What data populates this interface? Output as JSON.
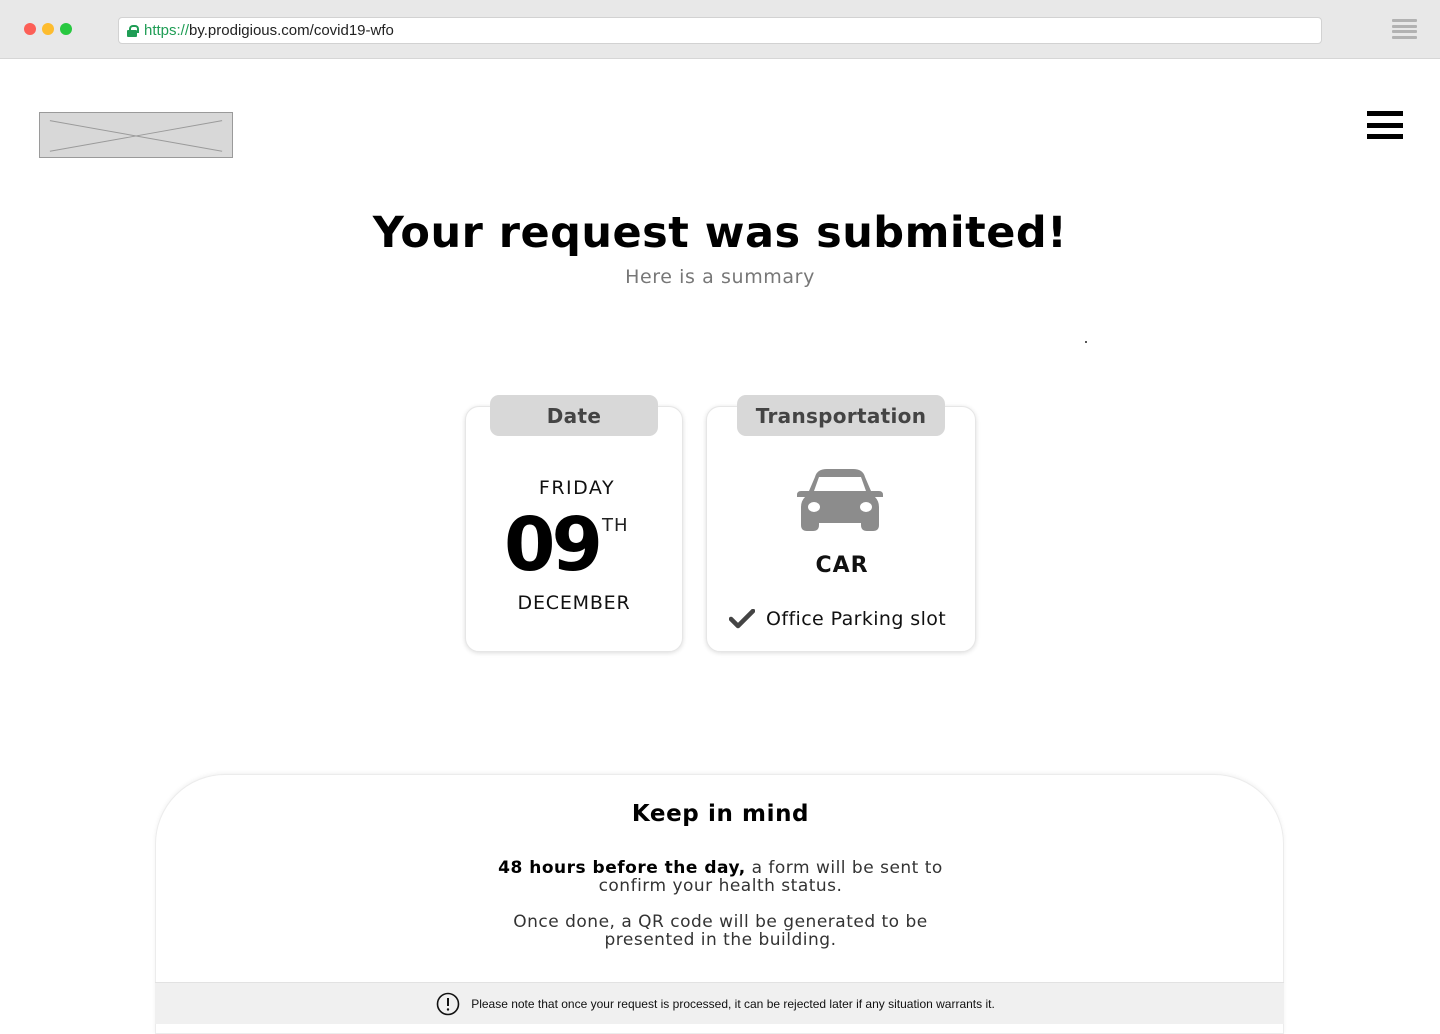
{
  "browser": {
    "url_scheme": "https://",
    "url_rest": "by.prodigious.com/covid19-wfo"
  },
  "header": {
    "logo_icon": "image-placeholder-icon",
    "menu_icon": "hamburger-menu-icon"
  },
  "hero": {
    "title": "Your request was submited!",
    "subtitle": "Here is a summary"
  },
  "date_card": {
    "tab_label": "Date",
    "weekday": "FRIDAY",
    "day": "09",
    "ordinal": "TH",
    "month": "DECEMBER"
  },
  "transport_card": {
    "tab_label": "Transportation",
    "icon": "car-icon",
    "mode": "CAR",
    "parking_check_icon": "checkmark-icon",
    "parking_label": "Office Parking slot"
  },
  "keep_in_mind": {
    "title": "Keep in mind",
    "p1_bold": "48 hours before the day,",
    "p1_line1_rest": " a form will be sent to",
    "p1_line2": "confirm your health status.",
    "p2_line1": "Once done, a QR code will be generated to be",
    "p2_line2": "presented in the building."
  },
  "notice": {
    "icon": "exclamation-circle-icon",
    "text": "Please note that once your request is processed, it can be rejected later if any situation warrants it."
  },
  "colors": {
    "tab_bg": "#d8d8d8",
    "icon_gray": "#8c8c8c",
    "url_green": "#1f9d55",
    "notice_bg": "#f0f0f0"
  }
}
